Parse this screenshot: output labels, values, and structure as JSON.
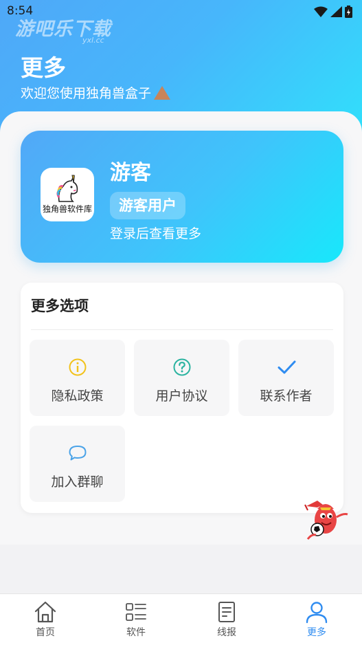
{
  "status": {
    "time": "8:54"
  },
  "watermark": {
    "text": "游吧乐下载",
    "sub": "yxl.cc"
  },
  "header": {
    "title": "更多",
    "subtitle": "欢迎您使用独角兽盒子"
  },
  "profile": {
    "avatar_caption": "独角兽软件库",
    "name": "游客",
    "badge": "游客用户",
    "hint": "登录后查看更多"
  },
  "options": {
    "title": "更多选项",
    "items": [
      {
        "label": "隐私政策",
        "icon": "info-icon",
        "color": "#f2c21a"
      },
      {
        "label": "用户协议",
        "icon": "question-icon",
        "color": "#2bb3a0"
      },
      {
        "label": "联系作者",
        "icon": "check-icon",
        "color": "#2f8cf0"
      },
      {
        "label": "加入群聊",
        "icon": "chat-bubble-icon",
        "color": "#4aa3e8"
      }
    ]
  },
  "tabbar": {
    "tabs": [
      {
        "label": "首页",
        "icon": "home-icon",
        "active": false
      },
      {
        "label": "软件",
        "icon": "list-grid-icon",
        "active": false
      },
      {
        "label": "线报",
        "icon": "document-icon",
        "active": false
      },
      {
        "label": "更多",
        "icon": "user-icon",
        "active": true
      }
    ]
  },
  "colors": {
    "accent": "#2f8cf0",
    "hero_start": "#4fa8f8",
    "hero_end": "#2fe3fb"
  }
}
